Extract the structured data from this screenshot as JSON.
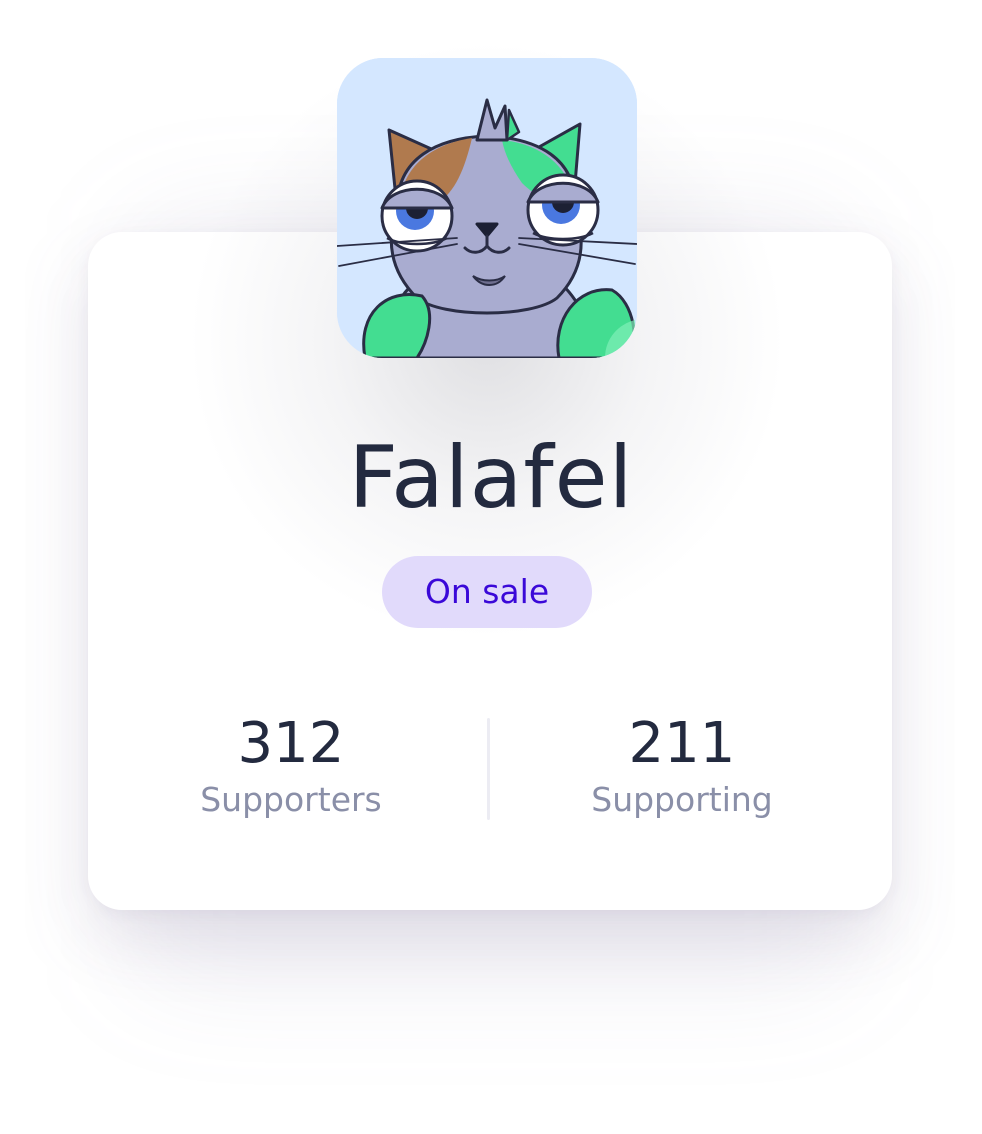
{
  "profile": {
    "name": "Falafel",
    "status_badge": "On sale",
    "avatar_icon": "cat-avatar-icon"
  },
  "stats": [
    {
      "value": "312",
      "label": "Supporters"
    },
    {
      "value": "211",
      "label": "Supporting"
    }
  ],
  "colors": {
    "avatar_background": "#d4e7ff",
    "badge_background": "#e1dafb",
    "badge_text": "#3a08d8",
    "name_text": "#232a3f",
    "label_text": "#8a8fa8"
  }
}
